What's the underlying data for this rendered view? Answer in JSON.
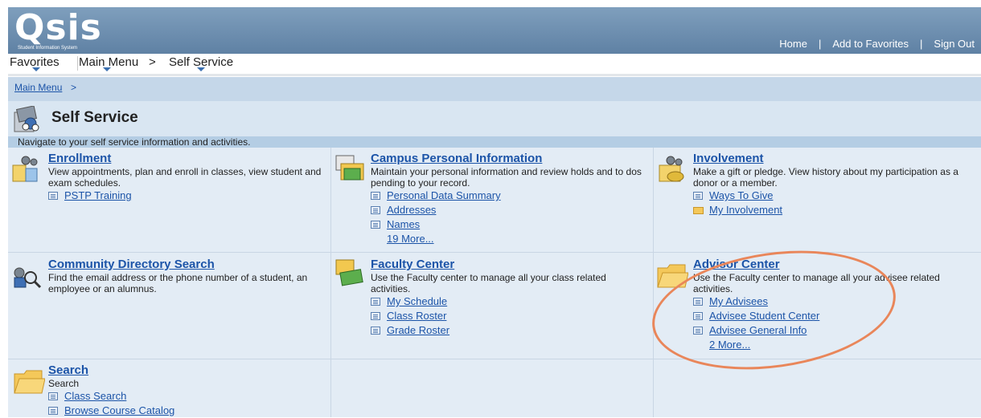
{
  "header": {
    "logo_text": "Qsis",
    "logo_subtext": "Student Information System",
    "links": [
      "Home",
      "Add to Favorites",
      "Sign Out"
    ]
  },
  "nav": {
    "favorites": "Favorites",
    "main_menu": "Main Menu",
    "separator": ">",
    "self_service": "Self Service"
  },
  "breadcrumb": {
    "main_menu": "Main Menu",
    "gt": ">"
  },
  "page": {
    "title": "Self Service",
    "description": "Navigate to your self service information and activities."
  },
  "cells": [
    {
      "title": "Enrollment",
      "desc": "View appointments, plan and enroll in classes, view student and exam schedules.",
      "links": [
        "PSTP Training"
      ]
    },
    {
      "title": "Campus Personal Information",
      "desc": "Maintain your personal information and review holds and to dos pending to your record.",
      "links": [
        "Personal Data Summary",
        "Addresses",
        "Names"
      ],
      "more": "19 More..."
    },
    {
      "title": "Involvement",
      "desc": "Make a gift or pledge. View history about my participation as a donor or a member.",
      "links": [
        "Ways To Give",
        "My Involvement"
      ]
    },
    {
      "title": "Community Directory Search",
      "desc": "Find the email address or the phone number of a student, an employee or an alumnus.",
      "links": []
    },
    {
      "title": "Faculty Center",
      "desc": "Use the Faculty center to manage all your class related activities.",
      "links": [
        "My Schedule",
        "Class Roster",
        "Grade Roster"
      ]
    },
    {
      "title": "Advisor Center",
      "desc": "Use the Faculty center to manage all your advisee related activities.",
      "links": [
        "My Advisees",
        "Advisee Student Center",
        "Advisee General Info"
      ],
      "more": "2 More..."
    },
    {
      "title": "Search",
      "desc": "Search",
      "links": [
        "Class Search",
        "Browse Course Catalog"
      ]
    }
  ],
  "colors": {
    "header": "#6a8bad",
    "link": "#1c54a8",
    "highlight_oval": "#e9865a"
  }
}
